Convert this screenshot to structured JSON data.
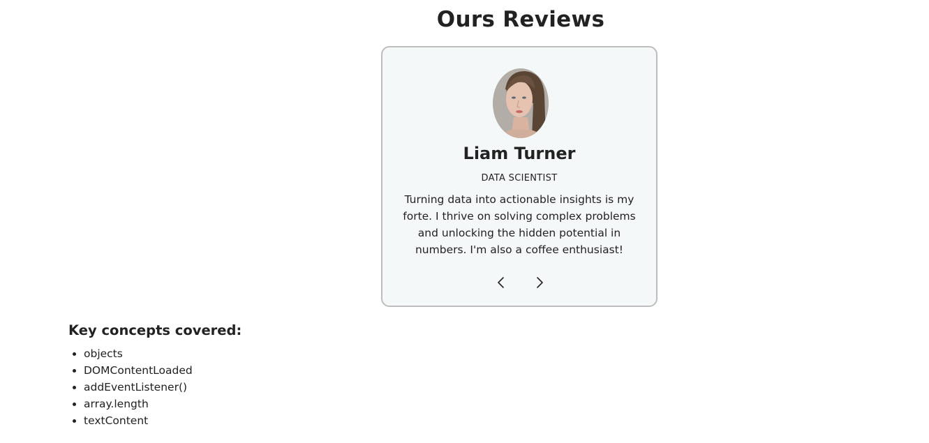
{
  "page": {
    "title": "Ours Reviews"
  },
  "review": {
    "name": "Liam Turner",
    "job": "DATA SCIENTIST",
    "text": "Turning data into actionable insights is my forte. I thrive on solving complex problems and unlocking the hidden potential in numbers. I'm also a coffee enthusiast!",
    "avatar_icon": "person-photo"
  },
  "navigation": {
    "prev_icon": "chevron-left-icon",
    "next_icon": "chevron-right-icon"
  },
  "concepts": {
    "title": "Key concepts covered:",
    "items": [
      "objects",
      "DOMContentLoaded",
      "addEventListener()",
      "array.length",
      "textContent"
    ]
  },
  "colors": {
    "card_background": "#f5f8f9",
    "card_border": "#bdbdbd",
    "text": "#222222"
  }
}
